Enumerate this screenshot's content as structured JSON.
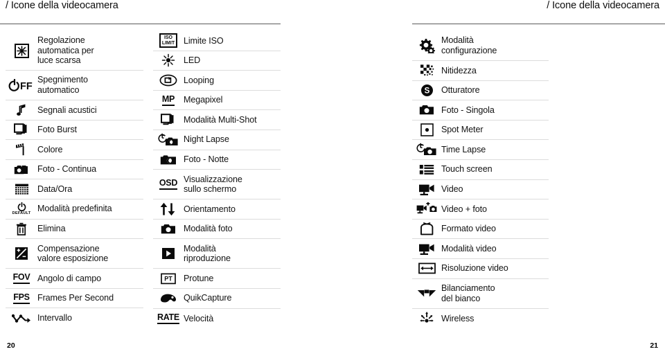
{
  "header": {
    "left_title": "/ Icone della videocamera",
    "right_title": "/ Icone della videocamera"
  },
  "footer": {
    "left_page": "20",
    "right_page": "21"
  },
  "colors": {
    "ink": "#0b0b0b",
    "rule": "#dcdcdc",
    "header_rule": "#5a5a5a",
    "background": "#ffffff"
  },
  "columns": [
    {
      "id": "column-left",
      "rows": [
        {
          "icon": "low-light-auto-icon",
          "label": "Regolazione\nautomatica per\nluce scarsa",
          "lines": 3
        },
        {
          "icon": "auto-off-icon",
          "label": "Spegnimento\nautomatico",
          "lines": 2
        },
        {
          "icon": "beep-sound-icon",
          "label": "Segnali acustici",
          "lines": 1
        },
        {
          "icon": "burst-photo-icon",
          "label": "Foto Burst",
          "lines": 1
        },
        {
          "icon": "color-icon",
          "label": "Colore",
          "lines": 1
        },
        {
          "icon": "continuous-photo-icon",
          "label": "Foto - Continua",
          "lines": 1
        },
        {
          "icon": "date-time-icon",
          "label": "Data/Ora",
          "lines": 1
        },
        {
          "icon": "default-mode-icon",
          "label": "Modalità predefinita",
          "lines": 1
        },
        {
          "icon": "delete-trash-icon",
          "label": "Elimina",
          "lines": 1
        },
        {
          "icon": "exposure-compensation-icon",
          "label": "Compensazione\nvalore esposizione",
          "lines": 2
        },
        {
          "icon": "fov-icon",
          "label": "Angolo di campo",
          "lines": 1
        },
        {
          "icon": "fps-icon",
          "label": "Frames Per Second",
          "lines": 1
        },
        {
          "icon": "interval-icon",
          "label": "Intervallo",
          "lines": 1
        }
      ]
    },
    {
      "id": "column-middle",
      "rows": [
        {
          "icon": "iso-limit-icon",
          "label": "Limite ISO",
          "lines": 1
        },
        {
          "icon": "led-icon",
          "label": "LED",
          "lines": 1
        },
        {
          "icon": "looping-icon",
          "label": "Looping",
          "lines": 1
        },
        {
          "icon": "megapixel-icon",
          "label": "Megapixel",
          "lines": 1
        },
        {
          "icon": "multi-shot-icon",
          "label": "Modalità Multi-Shot",
          "lines": 1
        },
        {
          "icon": "night-lapse-icon",
          "label": "Night Lapse",
          "lines": 1
        },
        {
          "icon": "night-photo-icon",
          "label": "Foto - Notte",
          "lines": 1
        },
        {
          "icon": "osd-icon",
          "label": "Visualizzazione\nsullo schermo",
          "lines": 2
        },
        {
          "icon": "orientation-icon",
          "label": "Orientamento",
          "lines": 1
        },
        {
          "icon": "photo-mode-icon",
          "label": "Modalità foto",
          "lines": 1
        },
        {
          "icon": "playback-mode-icon",
          "label": "Modalità\nriproduzione",
          "lines": 2
        },
        {
          "icon": "protune-icon",
          "label": "Protune",
          "lines": 1
        },
        {
          "icon": "quikcapture-icon",
          "label": "QuikCapture",
          "lines": 1
        },
        {
          "icon": "rate-icon",
          "label": "Velocità",
          "lines": 1
        }
      ]
    },
    {
      "id": "column-right",
      "rows": [
        {
          "icon": "setup-mode-icon",
          "label": "Modalità\nconfigurazione",
          "lines": 2
        },
        {
          "icon": "sharpness-icon",
          "label": "Nitidezza",
          "lines": 1
        },
        {
          "icon": "shutter-icon",
          "label": "Otturatore",
          "lines": 1
        },
        {
          "icon": "single-photo-icon",
          "label": "Foto - Singola",
          "lines": 1
        },
        {
          "icon": "spot-meter-icon",
          "label": "Spot Meter",
          "lines": 1
        },
        {
          "icon": "time-lapse-icon",
          "label": "Time Lapse",
          "lines": 1
        },
        {
          "icon": "touch-screen-icon",
          "label": "Touch screen",
          "lines": 1
        },
        {
          "icon": "video-icon",
          "label": "Video",
          "lines": 1
        },
        {
          "icon": "video-plus-photo-icon",
          "label": "Video + foto",
          "lines": 1
        },
        {
          "icon": "video-format-icon",
          "label": "Formato video",
          "lines": 1
        },
        {
          "icon": "video-mode-icon",
          "label": "Modalità video",
          "lines": 1
        },
        {
          "icon": "video-resolution-icon",
          "label": "Risoluzione video",
          "lines": 1
        },
        {
          "icon": "white-balance-icon",
          "label": "Bilanciamento\ndel bianco",
          "lines": 2
        },
        {
          "icon": "wireless-icon",
          "label": "Wireless",
          "lines": 1
        }
      ]
    }
  ]
}
